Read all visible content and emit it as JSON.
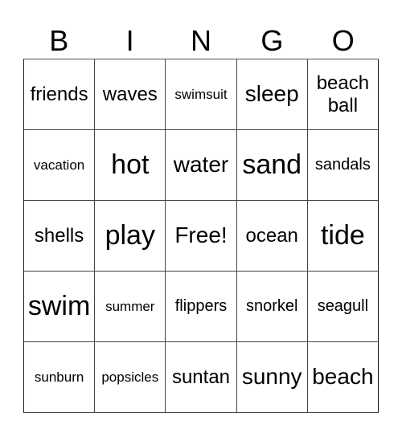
{
  "header": [
    "B",
    "I",
    "N",
    "G",
    "O"
  ],
  "cells": [
    [
      {
        "text": "friends",
        "size": "s-md"
      },
      {
        "text": "waves",
        "size": "s-md"
      },
      {
        "text": "swimsuit",
        "size": "s-xs"
      },
      {
        "text": "sleep",
        "size": "s-lg"
      },
      {
        "text": "beach ball",
        "size": "s-md"
      }
    ],
    [
      {
        "text": "vacation",
        "size": "s-xs"
      },
      {
        "text": "hot",
        "size": "s-xl"
      },
      {
        "text": "water",
        "size": "s-lg"
      },
      {
        "text": "sand",
        "size": "s-xl"
      },
      {
        "text": "sandals",
        "size": "s-sm"
      }
    ],
    [
      {
        "text": "shells",
        "size": "s-md"
      },
      {
        "text": "play",
        "size": "s-xl"
      },
      {
        "text": "Free!",
        "size": "s-lg"
      },
      {
        "text": "ocean",
        "size": "s-md"
      },
      {
        "text": "tide",
        "size": "s-xl"
      }
    ],
    [
      {
        "text": "swim",
        "size": "s-xl"
      },
      {
        "text": "summer",
        "size": "s-xs"
      },
      {
        "text": "flippers",
        "size": "s-sm"
      },
      {
        "text": "snorkel",
        "size": "s-sm"
      },
      {
        "text": "seagull",
        "size": "s-sm"
      }
    ],
    [
      {
        "text": "sunburn",
        "size": "s-xs"
      },
      {
        "text": "popsicles",
        "size": "s-xs"
      },
      {
        "text": "suntan",
        "size": "s-md"
      },
      {
        "text": "sunny",
        "size": "s-lg"
      },
      {
        "text": "beach",
        "size": "s-lg"
      }
    ]
  ]
}
